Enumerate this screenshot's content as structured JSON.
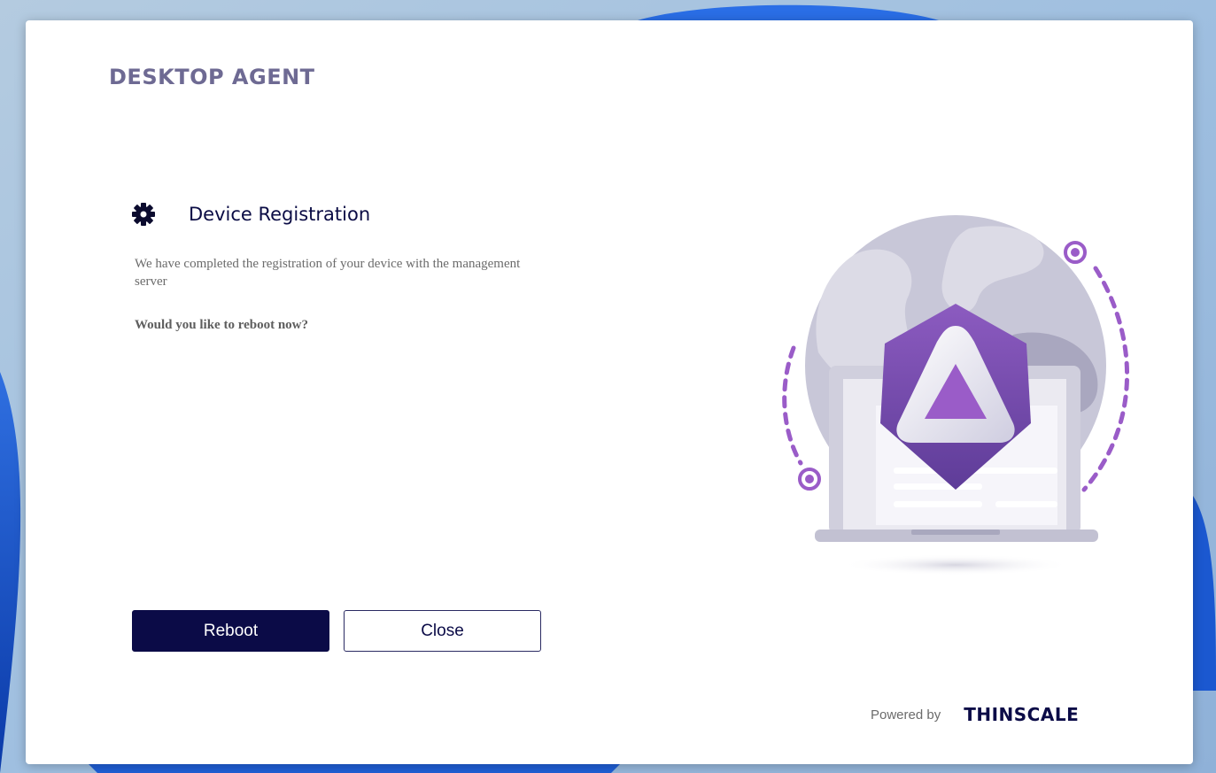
{
  "app": {
    "title": "DESKTOP AGENT"
  },
  "registration": {
    "icon": "gear-icon",
    "title": "Device Registration",
    "message": "We have completed the registration of your device with the management server",
    "question": "Would you like to reboot now?"
  },
  "actions": {
    "reboot_label": "Reboot",
    "close_label": "Close"
  },
  "footer": {
    "powered_by": "Powered by",
    "brand": "THINSCALE"
  },
  "colors": {
    "primary": "#0b0b47",
    "title_gray": "#6e6a93",
    "accent_purple": "#9a5cc8",
    "globe_gray": "#c6c4d6"
  }
}
